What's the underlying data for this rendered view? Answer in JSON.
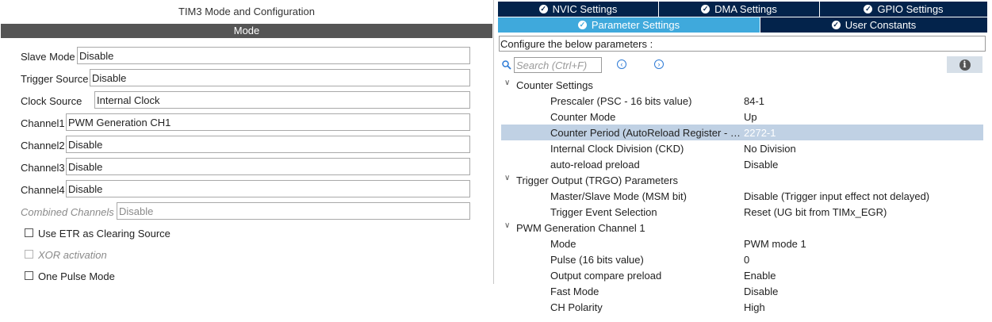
{
  "left": {
    "title": "TIM3 Mode and Configuration",
    "mode_bar": "Mode",
    "fields": [
      {
        "label": "Slave Mode",
        "value": "Disable"
      },
      {
        "label": "Trigger Source",
        "value": "Disable"
      },
      {
        "label": "Clock Source",
        "value": "Internal Clock"
      },
      {
        "label": "Channel1",
        "value": "PWM Generation CH1"
      },
      {
        "label": "Channel2",
        "value": "Disable"
      },
      {
        "label": "Channel3",
        "value": "Disable"
      },
      {
        "label": "Channel4",
        "value": "Disable"
      },
      {
        "label": "Combined Channels",
        "value": "Disable"
      }
    ],
    "checkboxes": [
      {
        "label": "Use ETR as Clearing Source",
        "checked": false
      },
      {
        "label": "XOR activation",
        "checked": false
      },
      {
        "label": "One Pulse Mode",
        "checked": false
      }
    ]
  },
  "right": {
    "tabs_top": [
      {
        "label": "NVIC Settings",
        "icon": "check-circle-icon"
      },
      {
        "label": "DMA Settings",
        "icon": "check-circle-icon"
      },
      {
        "label": "GPIO Settings",
        "icon": "check-circle-icon"
      }
    ],
    "tabs_bottom": [
      {
        "label": "Parameter Settings",
        "icon": "check-circle-icon",
        "active": true
      },
      {
        "label": "User Constants",
        "icon": "check-circle-icon",
        "active": false
      }
    ],
    "configure_text": "Configure the below parameters :",
    "search_placeholder": "Search (Ctrl+F)",
    "sections": [
      {
        "title": "Counter Settings",
        "params": [
          {
            "name": "Prescaler (PSC - 16 bits value)",
            "value": "84-1"
          },
          {
            "name": "Counter Mode",
            "value": "Up"
          },
          {
            "name": "Counter Period (AutoReload Register - …",
            "value": "2272-1"
          },
          {
            "name": "Internal Clock Division (CKD)",
            "value": "No Division"
          },
          {
            "name": "auto-reload preload",
            "value": "Disable"
          }
        ]
      },
      {
        "title": "Trigger Output (TRGO) Parameters",
        "params": [
          {
            "name": "Master/Slave Mode (MSM bit)",
            "value": "Disable (Trigger input effect not delayed)"
          },
          {
            "name": "Trigger Event Selection",
            "value": "Reset (UG bit from TIMx_EGR)"
          }
        ]
      },
      {
        "title": "PWM Generation Channel 1",
        "params": [
          {
            "name": "Mode",
            "value": "PWM mode 1"
          },
          {
            "name": "Pulse (16 bits value)",
            "value": "0"
          },
          {
            "name": "Output compare preload",
            "value": "Enable"
          },
          {
            "name": "Fast Mode",
            "value": "Disable"
          },
          {
            "name": "CH Polarity",
            "value": "High"
          }
        ]
      }
    ],
    "selected_param": "Counter Period (AutoReload Register - …"
  },
  "colors": {
    "tab_dark": "#03234b",
    "tab_active": "#3fa9dc",
    "selection": "#c0d1e4",
    "mode_bar": "#555555"
  }
}
